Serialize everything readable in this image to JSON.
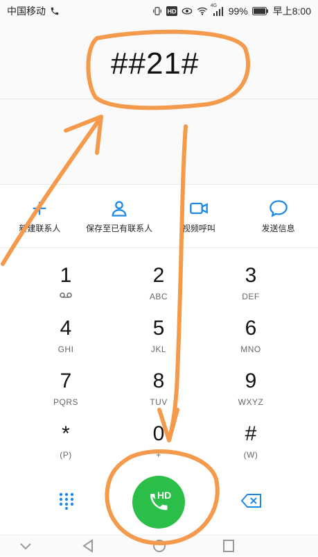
{
  "status": {
    "carrier": "中国移动",
    "battery": "99%",
    "time": "早上8:00",
    "net_type": "4G",
    "hd_badge": "HD"
  },
  "dialer": {
    "number": "##21#"
  },
  "actions": [
    {
      "label": "新建联系人",
      "icon": "add-contact-icon"
    },
    {
      "label": "保存至已有联系人",
      "icon": "person-icon"
    },
    {
      "label": "视频呼叫",
      "icon": "video-icon"
    },
    {
      "label": "发送信息",
      "icon": "message-icon"
    }
  ],
  "keys": [
    {
      "digit": "1",
      "letters": ""
    },
    {
      "digit": "2",
      "letters": "ABC"
    },
    {
      "digit": "3",
      "letters": "DEF"
    },
    {
      "digit": "4",
      "letters": "GHI"
    },
    {
      "digit": "5",
      "letters": "JKL"
    },
    {
      "digit": "6",
      "letters": "MNO"
    },
    {
      "digit": "7",
      "letters": "PQRS"
    },
    {
      "digit": "8",
      "letters": "TUV"
    },
    {
      "digit": "9",
      "letters": "WXYZ"
    },
    {
      "digit": "*",
      "letters": "(P)"
    },
    {
      "digit": "0",
      "letters": "+"
    },
    {
      "digit": "#",
      "letters": "(W)"
    }
  ],
  "call": {
    "badge": "HD"
  },
  "colors": {
    "accent": "#1e88e5",
    "call_green": "#2bbf4a",
    "annotation": "#f39a4c"
  }
}
